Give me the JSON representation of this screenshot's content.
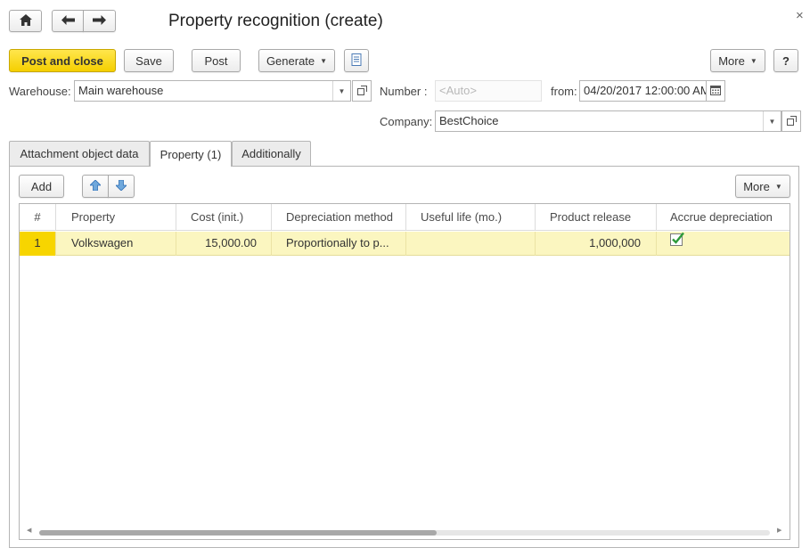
{
  "window": {
    "title": "Property recognition (create)",
    "close_glyph": "×"
  },
  "nav": {
    "home_icon": "home-icon",
    "back_icon": "arrow-left-icon",
    "forward_icon": "arrow-right-icon"
  },
  "toolbar": {
    "post_and_close": "Post and close",
    "save": "Save",
    "post": "Post",
    "generate": "Generate",
    "more": "More",
    "help": "?"
  },
  "form": {
    "warehouse_label": "Warehouse:",
    "warehouse_value": "Main warehouse",
    "number_label": "Number :",
    "number_placeholder": "<Auto>",
    "from_label": "from:",
    "from_value": "04/20/2017 12:00:00 AM",
    "company_label": "Company:",
    "company_value": "BestChoice"
  },
  "tabs": [
    {
      "label": "Attachment object data",
      "active": false
    },
    {
      "label": "Property (1)",
      "active": true
    },
    {
      "label": "Additionally",
      "active": false
    }
  ],
  "table_toolbar": {
    "add": "Add",
    "more": "More"
  },
  "table": {
    "columns": [
      "#",
      "Property",
      "Cost (init.)",
      "Depreciation method",
      "Useful life (mo.)",
      "Product release",
      "Accrue depreciation"
    ],
    "rows": [
      {
        "num": "1",
        "property": "Volkswagen",
        "cost": "15,000.00",
        "method": "Proportionally to p...",
        "useful_life": "",
        "product_release": "1,000,000",
        "accrue": true
      }
    ]
  },
  "colors": {
    "primary_button": "#f5cf00",
    "selected_row": "#fbf6c0",
    "selected_cell": "#f7d500",
    "check_green": "#2e9a3a"
  }
}
